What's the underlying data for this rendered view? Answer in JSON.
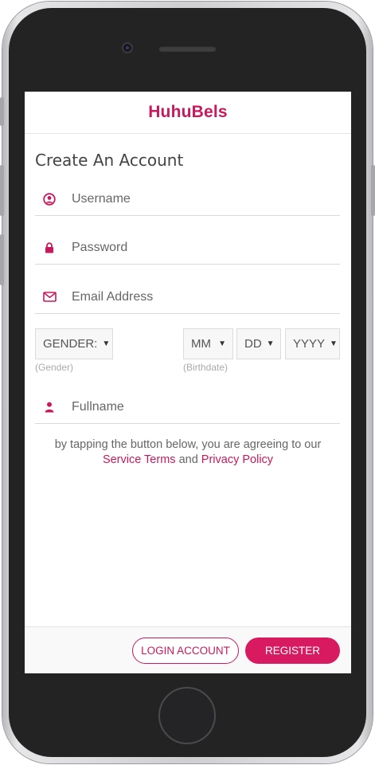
{
  "app": {
    "brand": "HuhuBels"
  },
  "form": {
    "title": "Create An Account",
    "username": {
      "placeholder": "Username",
      "icon": "user-circle-icon"
    },
    "password": {
      "placeholder": "Password",
      "icon": "lock-icon"
    },
    "email": {
      "placeholder": "Email Address",
      "icon": "envelope-icon"
    },
    "gender": {
      "value": "GENDER:",
      "hint": "(Gender)"
    },
    "birthdate": {
      "month": "MM",
      "day": "DD",
      "year": "YYYY",
      "hint": "(Birthdate)"
    },
    "fullname": {
      "placeholder": "Fullname",
      "icon": "person-icon"
    }
  },
  "terms": {
    "text": "by tapping the button below, you are agreeing to our",
    "service_link": "Service Terms",
    "and": "and",
    "privacy_link": "Privacy Policy"
  },
  "footer": {
    "login_label": "LOGIN ACCOUNT",
    "register_label": "REGISTER"
  },
  "colors": {
    "accent": "#c9185e",
    "button": "#d81b60"
  }
}
